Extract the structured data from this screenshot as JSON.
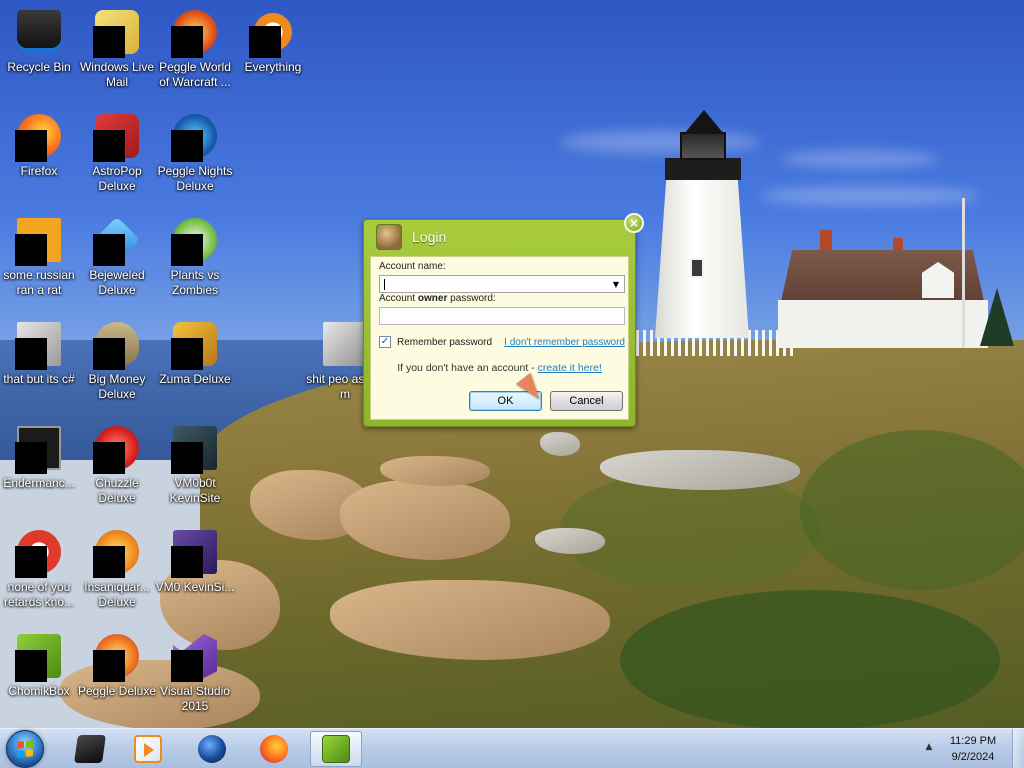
{
  "desktop": {
    "icons": [
      {
        "label": "Recycle Bin",
        "icon": "recycle-bin-icon"
      },
      {
        "label": "Windows Live Mail",
        "icon": "mail-icon"
      },
      {
        "label": "Peggle World of Warcraft ...",
        "icon": "peggle-icon"
      },
      {
        "label": "Everything",
        "icon": "search-tool-icon"
      },
      {
        "label": "Firefox",
        "icon": "firefox-icon"
      },
      {
        "label": "AstroPop Deluxe",
        "icon": "game-icon"
      },
      {
        "label": "Peggle Nights Deluxe",
        "icon": "peggle-icon"
      },
      {
        "label": "some russian ran a rat",
        "icon": "file-icon"
      },
      {
        "label": "Bejeweled Deluxe",
        "icon": "gem-icon"
      },
      {
        "label": "Plants vs Zombies",
        "icon": "game-icon"
      },
      {
        "label": "that but its c#",
        "icon": "file-icon"
      },
      {
        "label": "Big Money Deluxe",
        "icon": "game-icon"
      },
      {
        "label": "Zuma Deluxe",
        "icon": "game-icon"
      },
      {
        "label": "shit peo asked m",
        "icon": "file-icon"
      },
      {
        "label": "Endermanc...",
        "icon": "app-icon"
      },
      {
        "label": "Chuzzle Deluxe",
        "icon": "game-icon"
      },
      {
        "label": "VM0b0t KevinSite",
        "icon": "app-icon"
      },
      {
        "label": "none of you retards kno...",
        "icon": "browser-icon"
      },
      {
        "label": "Insaniquar... Deluxe",
        "icon": "game-icon"
      },
      {
        "label": "VM0 KevinSi...",
        "icon": "app-icon"
      },
      {
        "label": "ChomikBox",
        "icon": "chomikbox-icon"
      },
      {
        "label": "Peggle Deluxe",
        "icon": "peggle-icon"
      },
      {
        "label": "Visual Studio 2015",
        "icon": "visual-studio-icon"
      }
    ]
  },
  "login": {
    "title": "Login",
    "close_glyph": "×",
    "account_name_label": "Account name:",
    "password_label_prefix": "Account ",
    "password_label_bold": "owner",
    "password_label_suffix": " password:",
    "account_name_value": "",
    "password_value": "",
    "remember_checked": true,
    "remember_label": "Remember password",
    "forgot_link": "I don't remember password",
    "signup_text": "If you don't have an account - ",
    "signup_link": "create it here!",
    "ok_label": "OK",
    "cancel_label": "Cancel"
  },
  "taskbar": {
    "items": [
      {
        "icon": "terminal-icon"
      },
      {
        "icon": "media-player-icon"
      },
      {
        "icon": "browser-globe-icon"
      },
      {
        "icon": "firefox-icon"
      },
      {
        "icon": "chomikbox-icon",
        "active": true
      }
    ],
    "tray_arrow": "▲",
    "time": "11:29 PM",
    "date": "9/2/2024"
  },
  "colors": {
    "dialog_green": "#8db52a",
    "dialog_body": "#fdfce0",
    "link_blue": "#1e7fc6"
  }
}
